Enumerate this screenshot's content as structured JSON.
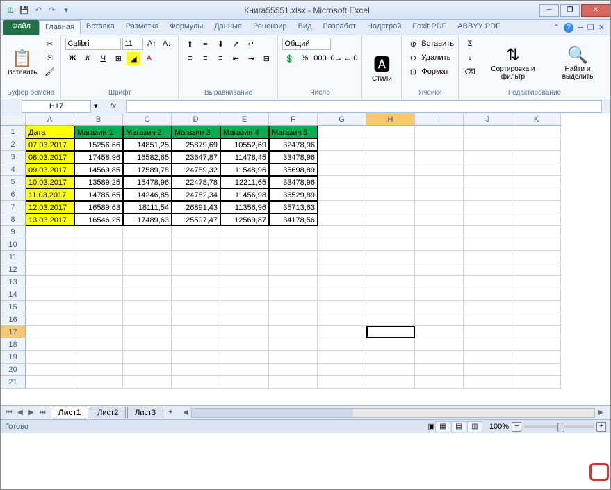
{
  "title": "Книга55551.xlsx - Microsoft Excel",
  "ribbon_tabs": {
    "file": "Файл",
    "items": [
      "Главная",
      "Вставка",
      "Разметка",
      "Формулы",
      "Данные",
      "Рецензир",
      "Вид",
      "Разработ",
      "Надстрой",
      "Foxit PDF",
      "ABBYY PDF"
    ],
    "active": 0
  },
  "ribbon_groups": {
    "clipboard": {
      "label": "Буфер обмена",
      "paste": "Вставить"
    },
    "font": {
      "label": "Шрифт",
      "name": "Calibri",
      "size": "11"
    },
    "alignment": {
      "label": "Выравнивание"
    },
    "number": {
      "label": "Число",
      "format": "Общий"
    },
    "styles": {
      "label": "Стили",
      "btn": "Стили"
    },
    "cells": {
      "label": "Ячейки",
      "insert": "Вставить",
      "delete": "Удалить",
      "format": "Формат"
    },
    "editing": {
      "label": "Редактирование",
      "sort": "Сортировка и фильтр",
      "find": "Найти и выделить"
    }
  },
  "name_box": "H17",
  "columns": [
    "A",
    "B",
    "C",
    "D",
    "E",
    "F",
    "G",
    "H",
    "I",
    "J",
    "K"
  ],
  "selected_col": "H",
  "selected_row": 17,
  "chart_data": {
    "type": "table",
    "headers": [
      "Дата",
      "Магазин 1",
      "Магазин 2",
      "Магазин 3",
      "Магазин 4",
      "Магазин 5"
    ],
    "rows": [
      [
        "07.03.2017",
        "15256,66",
        "14851,25",
        "25879,69",
        "10552,69",
        "32478,96"
      ],
      [
        "08.03.2017",
        "17458,96",
        "16582,65",
        "23647,87",
        "11478,45",
        "33478,96"
      ],
      [
        "09.03.2017",
        "14569,85",
        "17589,78",
        "24789,32",
        "11548,96",
        "35698,89"
      ],
      [
        "10.03.2017",
        "13589,25",
        "15478,96",
        "22478,78",
        "12211,65",
        "33478,96"
      ],
      [
        "11.03.2017",
        "14785,65",
        "14246,85",
        "24782,34",
        "11456,98",
        "36529,89"
      ],
      [
        "12.03.2017",
        "16589,63",
        "18111,54",
        "26891,43",
        "11356,96",
        "35713,63"
      ],
      [
        "13.03.2017",
        "16546,25",
        "17489,63",
        "25597,47",
        "12569,87",
        "34178,56"
      ]
    ]
  },
  "sheets": [
    "Лист1",
    "Лист2",
    "Лист3"
  ],
  "active_sheet": 0,
  "status": "Готово",
  "zoom": "100%"
}
